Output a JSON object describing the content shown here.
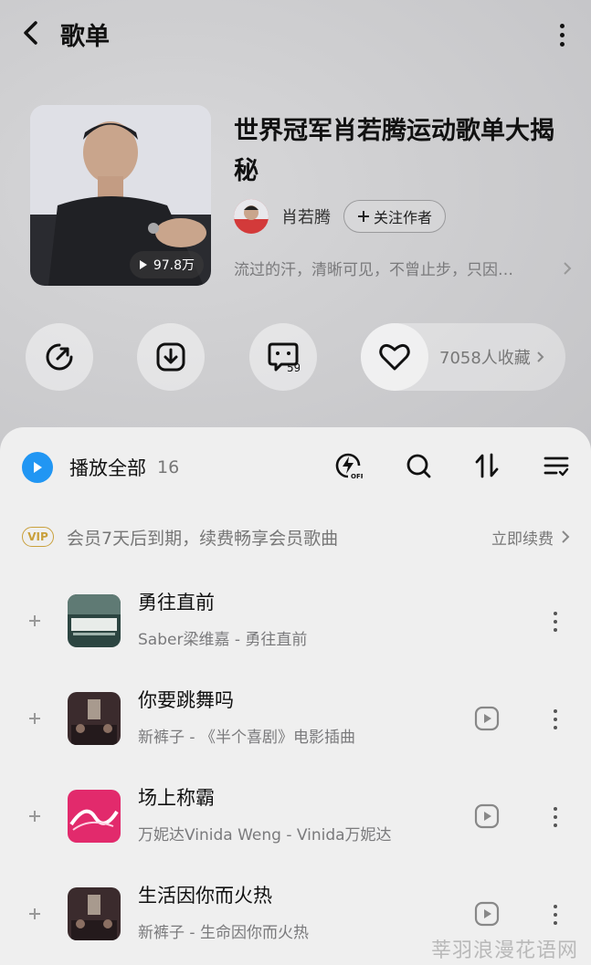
{
  "header": {
    "title": "歌单"
  },
  "playlist": {
    "title": "世界冠军肖若腾运动歌单大揭秘",
    "play_count": "97.8万",
    "author_name": "肖若腾",
    "follow_label": "关注作者",
    "description": "流过的汗，清晰可见，不曾止步，只因…"
  },
  "actions": {
    "comment_count": "59",
    "favorites_label": "7058人收藏"
  },
  "list": {
    "play_all_label": "播放全部",
    "count": "16"
  },
  "vip": {
    "badge": "VIP",
    "text": "会员7天后到期，续费畅享会员歌曲",
    "renew_label": "立即续费"
  },
  "songs": [
    {
      "title": "勇往直前",
      "subtitle": "Saber梁维嘉 - 勇往直前",
      "has_mv": false,
      "art_color": "#2f4a45"
    },
    {
      "title": "你要跳舞吗",
      "subtitle": "新裤子 - 《半个喜剧》电影插曲",
      "has_mv": true,
      "art_color": "#3a2a2c"
    },
    {
      "title": "场上称霸",
      "subtitle": "万妮达Vinida Weng - Vinida万妮达",
      "has_mv": true,
      "art_color": "#e02a6a"
    },
    {
      "title": "生活因你而火热",
      "subtitle": "新裤子 - 生命因你而火热",
      "has_mv": true,
      "art_color": "#3a2a2c"
    }
  ],
  "watermark": "莘羽浪漫花语网"
}
